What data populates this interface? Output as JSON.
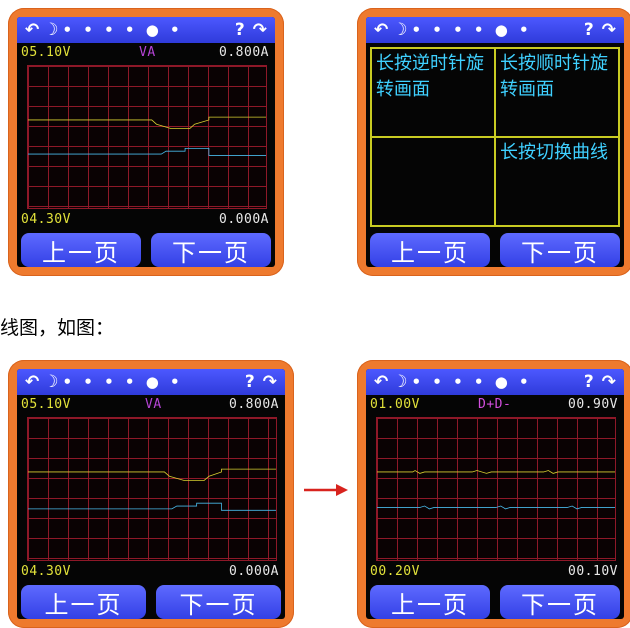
{
  "screens": [
    {
      "name": "va-curve-top-left",
      "voltage_top": "05.10V",
      "mode": "VA",
      "current_top": "0.800A",
      "voltage_bottom": "04.30V",
      "current_bottom": "0.000A",
      "prev_label": "上一页",
      "next_label": "下一页"
    },
    {
      "name": "menu-top-right",
      "cells": [
        "长按逆时针旋转画面",
        "长按顺时针旋转画面",
        "",
        "长按切换曲线"
      ],
      "prev_label": "上一页",
      "next_label": "下一页"
    },
    {
      "name": "va-curve-bottom-left",
      "voltage_top": "05.10V",
      "mode": "VA",
      "current_top": "0.800A",
      "voltage_bottom": "04.30V",
      "current_bottom": "0.000A",
      "prev_label": "上一页",
      "next_label": "下一页"
    },
    {
      "name": "dd-curve-bottom-right",
      "voltage_top": "01.00V",
      "mode": "D+D-",
      "current_top": "00.90V",
      "voltage_bottom": "00.20V",
      "current_bottom": "00.10V",
      "prev_label": "上一页",
      "next_label": "下一页"
    }
  ],
  "titlebar": {
    "left_icons": [
      "rotate-ccw-icon",
      "moon-icon"
    ],
    "dots": "• • • • ● •",
    "right_icons": [
      "question-icon",
      "rotate-cw-icon"
    ]
  },
  "caption": "线图，如图：",
  "colors": {
    "device": "#ee7a2e",
    "titlebar": "#3a46f0",
    "grid": "#8e1828",
    "voltage_trace": "#d6cf30",
    "current_trace": "#48b8e8",
    "voltage_text": "#e2e23a",
    "mode_va": "#b544d6",
    "mode_dd": "#d44fe0",
    "current_text": "#e8e8e8",
    "arrow": "#d8231e"
  }
}
